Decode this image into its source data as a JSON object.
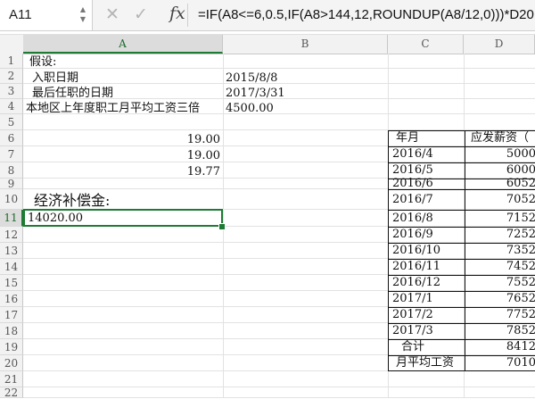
{
  "formula_bar": {
    "cell_ref": "A11",
    "formula": "=IF(A8<=6,0.5,IF(A8>144,12,ROUNDUP(A8/12,0)))*D20",
    "cancel_glyph": "✕",
    "confirm_glyph": "✓",
    "fx_label": "fx",
    "stepper_up": "▲",
    "stepper_down": "▼"
  },
  "columns": [
    "A",
    "B",
    "C",
    "D"
  ],
  "rows": [
    "1",
    "2",
    "3",
    "4",
    "5",
    "6",
    "7",
    "8",
    "9",
    "10",
    "11",
    "12",
    "13",
    "14",
    "15",
    "16",
    "17",
    "18",
    "19",
    "20",
    "21",
    "22"
  ],
  "cells": {
    "a1": "假设:",
    "a2": "入职日期",
    "b2": "2015/8/8",
    "a3": "最后任职的日期",
    "b3": "2017/3/31",
    "a4": "本地区上年度职工月平均工资三倍",
    "b4": "4500.00",
    "a6": "19.00",
    "a7": "19.00",
    "a8": "19.77",
    "a10": "经济补偿金:",
    "a11": "14020.00"
  },
  "salary_table": {
    "headers": [
      "年月",
      "应发薪资（"
    ],
    "rows": [
      {
        "month": "2016/4",
        "amount": "5000"
      },
      {
        "month": "2016/5",
        "amount": "6000"
      },
      {
        "month": "2016/6",
        "amount": "6052"
      },
      {
        "month": "2016/7",
        "amount": "7052"
      },
      {
        "month": "2016/8",
        "amount": "7152"
      },
      {
        "month": "2016/9",
        "amount": "7252"
      },
      {
        "month": "2016/10",
        "amount": "7352"
      },
      {
        "month": "2016/11",
        "amount": "7452"
      },
      {
        "month": "2016/12",
        "amount": "7552"
      },
      {
        "month": "2017/1",
        "amount": "7652"
      },
      {
        "month": "2017/2",
        "amount": "7752"
      },
      {
        "month": "2017/3",
        "amount": "7852"
      }
    ],
    "total_label": "合计",
    "total_value": "8412",
    "avg_label": "月平均工资",
    "avg_value": "7010"
  }
}
